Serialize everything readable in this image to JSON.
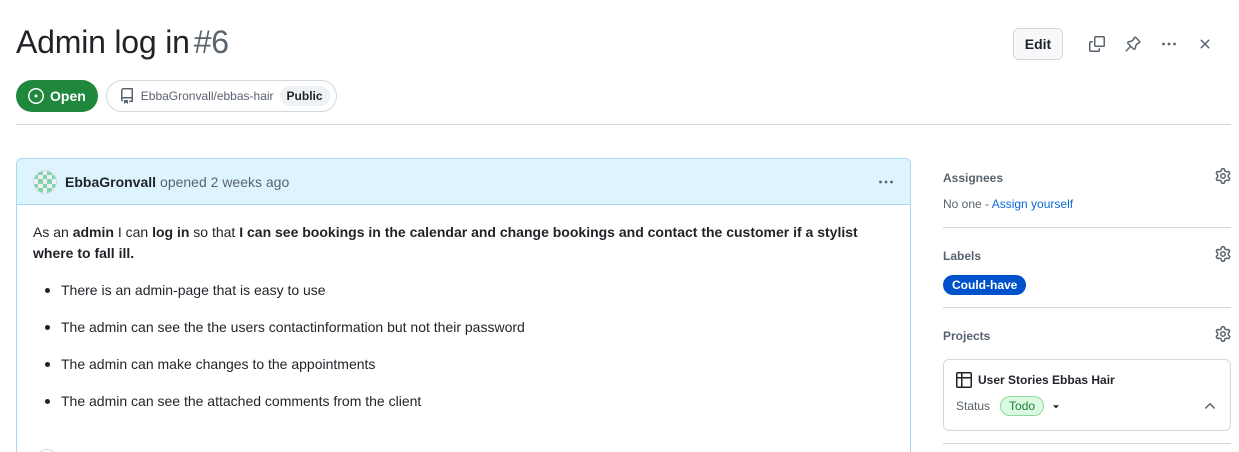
{
  "issue": {
    "title": "Admin log in",
    "number": "#6",
    "state": "Open",
    "repo": "EbbaGronvall/ebbas-hair",
    "visibility": "Public"
  },
  "toolbar": {
    "edit_label": "Edit",
    "icons": [
      "copy-icon",
      "pin-icon",
      "kebab-horizontal-icon",
      "close-icon"
    ]
  },
  "comment": {
    "author": "EbbaGronvall",
    "opened_text": "opened 2 weeks ago",
    "intro": {
      "p1": "As an ",
      "b1": "admin",
      "p2": " I can ",
      "b2": "log in",
      "p3": " so that ",
      "b3": "I can see bookings in the calendar and change bookings and contact the customer if a stylist where to fall ill."
    },
    "bullets": [
      "There is an admin-page that is easy to use",
      "The admin can see the the users contactinformation but not their password",
      "The admin can make changes to the appointments",
      "The admin can see the attached comments from the client"
    ]
  },
  "sidebar": {
    "assignees": {
      "heading": "Assignees",
      "none_text": "No one - ",
      "assign_link": "Assign yourself"
    },
    "labels": {
      "heading": "Labels",
      "items": [
        "Could-have"
      ],
      "chip_color": "#0052cc"
    },
    "projects": {
      "heading": "Projects",
      "project_name": "User Stories Ebbas Hair",
      "status_label": "Status",
      "status_value": "Todo"
    }
  },
  "colors": {
    "open_green": "#1f883d",
    "comment_header": "#ddf4ff",
    "comment_border": "#a9d6f3",
    "link_blue": "#0969da"
  }
}
